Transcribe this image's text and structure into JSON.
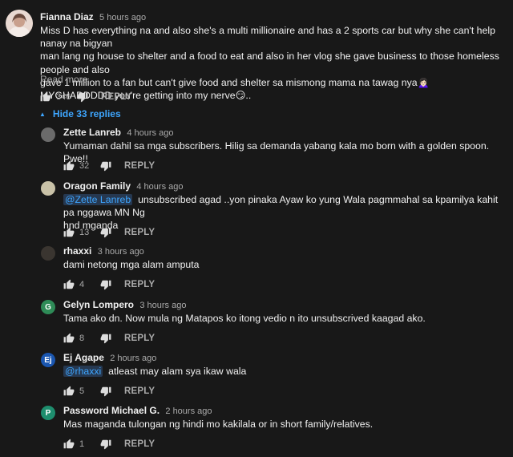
{
  "top_comment": {
    "author": "Fianna Diaz",
    "time": "5 hours ago",
    "lines": [
      "Miss D has everything na and also she's a multi millionaire and has a 2 sports car but why she can't help nanay na bigyan",
      "man lang ng house to shelter and a food to eat and also in her vlog she gave business to those homeless people and also",
      "gave 1 million to a fan but can't give  food and shelter sa mismong mama na tawag nya🙍🏻‍♀️",
      "MYGHADDDDD you're getting into my nerve😏.."
    ],
    "read_more": "Read more",
    "likes": "346",
    "reply_label": "REPLY"
  },
  "hide_replies_label": "Hide 33 replies",
  "replies": [
    {
      "author": "Zette Lanreb",
      "time": "4 hours ago",
      "lines": [
        "Yumaman dahil sa mga subscribers. Hilig sa demanda yabang kala mo born with a golden spoon. Pwe!!"
      ],
      "likes": "32",
      "reply_label": "REPLY",
      "avatar_color": "#6b6b6b",
      "avatar_letter": ""
    },
    {
      "author": "Oragon Family",
      "time": "4 hours ago",
      "mention": "@Zette Lanreb",
      "lines": [
        "unsubscribed agad ..yon pinaka Ayaw ko yung Wala pagmmahal sa kpamilya kahit pa nggawa MN Ng",
        "hnd mganda"
      ],
      "likes": "13",
      "reply_label": "REPLY",
      "avatar_color": "#c9c2a8",
      "avatar_letter": ""
    },
    {
      "author": "rhaxxi",
      "time": "3 hours ago",
      "lines": [
        "dami netong mga alam amputa"
      ],
      "likes": "4",
      "reply_label": "REPLY",
      "avatar_color": "#3a3530",
      "avatar_letter": ""
    },
    {
      "author": "Gelyn Lompero",
      "time": "3 hours ago",
      "lines": [
        "Tama ako dn. Now mula ng Matapos ko itong vedio n ito unsubscrived kaagad ako."
      ],
      "likes": "8",
      "reply_label": "REPLY",
      "avatar_color": "#2e8b57",
      "avatar_letter": "G"
    },
    {
      "author": "Ej Agape",
      "time": "2 hours ago",
      "mention": "@rhaxxi",
      "lines": [
        "atleast may alam sya ikaw wala"
      ],
      "likes": "5",
      "reply_label": "REPLY",
      "avatar_color": "#1a56b0",
      "avatar_letter": "Ej"
    },
    {
      "author": "Password Michael G.",
      "time": "2 hours ago",
      "lines": [
        "Mas maganda tulongan ng hindi mo kakilala or in short family/relatives."
      ],
      "likes": "1",
      "reply_label": "REPLY",
      "avatar_color": "#1e8e6e",
      "avatar_letter": "P"
    }
  ]
}
